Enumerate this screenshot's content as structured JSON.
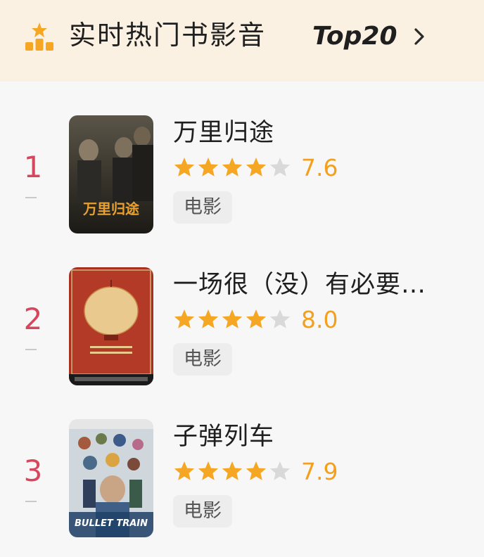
{
  "header": {
    "title": "实时热门书影音",
    "suffix": "Top20",
    "chevron": "chevron-right-icon",
    "icon": "ranking-bars-star-icon"
  },
  "colors": {
    "rank": "#d6465c",
    "star_on": "#f5a623",
    "star_off": "#d9d9d9",
    "score": "#f2a01e",
    "header_bg": "#fbf1e3"
  },
  "items": [
    {
      "rank": "1",
      "title": "万里归途",
      "rating": 3.8,
      "score": "7.6",
      "tag": "电影",
      "poster_text": "万里归途"
    },
    {
      "rank": "2",
      "title": "一场很（没）有必要…",
      "rating": 4.0,
      "score": "8.0",
      "tag": "电影"
    },
    {
      "rank": "3",
      "title": "子弹列车",
      "rating": 3.95,
      "score": "7.9",
      "tag": "电影",
      "poster_text": "BULLET TRAIN"
    }
  ]
}
